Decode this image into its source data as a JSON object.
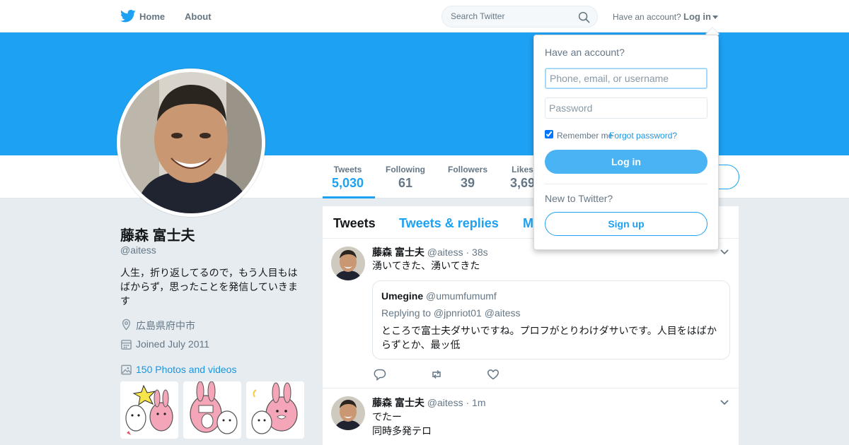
{
  "nav": {
    "logo": "twitter-bird",
    "home": "Home",
    "about": "About",
    "search_placeholder": "Search Twitter",
    "have_account": "Have an account?",
    "login": "Log in"
  },
  "colors": {
    "brand": "#1da1f2",
    "link": "#1b95e0",
    "banner": "#1da1f2",
    "login_button": "#4ab3f4"
  },
  "profile": {
    "name": "藤森 富士夫",
    "handle": "@aitess",
    "bio": "人生，折り返してるので，もう人目もはばからず，思ったことを発信していきます",
    "location": "広島県府中市",
    "joined": "Joined July 2011",
    "photos": "150 Photos and videos"
  },
  "stats": [
    {
      "label": "Tweets",
      "value": "5,030"
    },
    {
      "label": "Following",
      "value": "61"
    },
    {
      "label": "Followers",
      "value": "39"
    },
    {
      "label": "Likes",
      "value": "3,69"
    }
  ],
  "timeline_tabs": [
    "Tweets",
    "Tweets & replies",
    "M"
  ],
  "tweets": [
    {
      "name": "藤森 富士夫",
      "handle": "@aitess",
      "time": "38s",
      "text": "湧いてきた、湧いてきた",
      "quote": {
        "name": "Umegine",
        "handle": "@umumfumumf",
        "replying": "Replying to @jpnriot01 @aitess",
        "text": "ところで富士夫ダサいですね。プロフがとりわけダサいです。人目をはばからずとか、最ッ低"
      }
    },
    {
      "name": "藤森 富士夫",
      "handle": "@aitess",
      "time": "1m",
      "text_line1": "でたー",
      "text_line2": "同時多発テロ"
    }
  ],
  "login_dropdown": {
    "title": "Have an account?",
    "username_placeholder": "Phone, email, or username",
    "password_placeholder": "Password",
    "remember": "Remember me",
    "separator": "·",
    "forgot": "Forgot password?",
    "login_button": "Log in",
    "new_to_twitter": "New to Twitter?",
    "signup_button": "Sign up"
  }
}
